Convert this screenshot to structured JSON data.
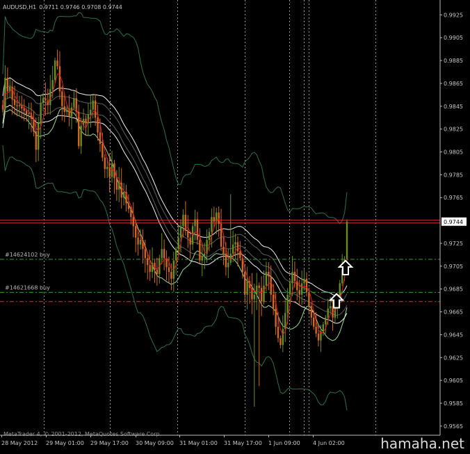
{
  "header": {
    "symbol": "AUDUSD,H1",
    "ohlc": "0.9711 0.9746 0.9708 0.9744"
  },
  "footer": {
    "copyright": "MetaTrader 4, © 2001-2012, MetaQuotes Software Corp.",
    "watermark": "hamaha.net"
  },
  "colors": {
    "background": "#000000",
    "grid": "#9a9a9a",
    "bull_candle": "#6b8e23",
    "bear_candle": "#d2691e",
    "red_ma": "#e02020",
    "bands": "#2f6f4f",
    "white_envelope": "#ffffff",
    "gray_envelope": "#a0a0a0",
    "green_envelope": "#b8ffb8",
    "bid_line": "#e03030",
    "order_line": "#3c9a3c",
    "stop_line": "#e03030",
    "price_tag": "#ffffff"
  },
  "chart_data": {
    "type": "candlestick",
    "y_axis_ticks": [
      "0.9925",
      "0.9905",
      "0.9885",
      "0.9865",
      "0.9845",
      "0.9825",
      "0.9805",
      "0.9785",
      "0.9765",
      "0.9744",
      "0.9725",
      "0.9705",
      "0.9685",
      "0.9665",
      "0.9645",
      "0.9625",
      "0.9605",
      "0.9585",
      "0.9565"
    ],
    "ylim": [
      0.9557,
      0.9938
    ],
    "x_axis_labels": [
      "28 May 2012",
      "29 May 01:00",
      "29 May 17:00",
      "30 May 09:00",
      "31 May 01:00",
      "31 May 17:00",
      "1 Jun 09:00",
      "4 Jun 02:00"
    ],
    "current_price": 0.9744,
    "orders": [
      {
        "label": "#14624102 buy",
        "price": 0.9711
      },
      {
        "label": "#14621668 buy",
        "price": 0.9682
      }
    ],
    "stop_price": 0.9674,
    "close_path": [
      0.9842,
      0.987,
      0.9858,
      0.9862,
      0.9851,
      0.9846,
      0.9845,
      0.9846,
      0.9843,
      0.9841,
      0.9838,
      0.9839,
      0.9834,
      0.9823,
      0.9807,
      0.983,
      0.9848,
      0.9852,
      0.985,
      0.9846,
      0.986,
      0.9868,
      0.9885,
      0.988,
      0.9858,
      0.9845,
      0.984,
      0.9842,
      0.9836,
      0.9844,
      0.9852,
      0.984,
      0.981,
      0.9828,
      0.9834,
      0.983,
      0.9838,
      0.9842,
      0.985,
      0.9835,
      0.9822,
      0.9812,
      0.98,
      0.979,
      0.9792,
      0.9783,
      0.9795,
      0.9782,
      0.9772,
      0.9778,
      0.9765,
      0.977,
      0.976,
      0.9755,
      0.9748,
      0.974,
      0.973,
      0.9724,
      0.9728,
      0.972,
      0.9712,
      0.9706,
      0.97,
      0.9708,
      0.9702,
      0.9698,
      0.9712,
      0.972,
      0.9712,
      0.9704,
      0.97,
      0.9694,
      0.971,
      0.972,
      0.973,
      0.974,
      0.975,
      0.9736,
      0.973,
      0.9724,
      0.974,
      0.9746,
      0.9728,
      0.971,
      0.9714,
      0.9716,
      0.9728,
      0.9735,
      0.9748,
      0.9744,
      0.9752,
      0.9742,
      0.9722,
      0.9716,
      0.9704,
      0.9708,
      0.9716,
      0.9724,
      0.9726,
      0.9718,
      0.9712,
      0.97,
      0.968,
      0.9692,
      0.9686,
      0.9676,
      0.968,
      0.9688,
      0.9686,
      0.9674,
      0.9688,
      0.97,
      0.9696,
      0.968,
      0.9668,
      0.9652,
      0.9642,
      0.9636,
      0.965,
      0.9664,
      0.968,
      0.969,
      0.97,
      0.9692,
      0.9684,
      0.968,
      0.969,
      0.9694,
      0.9682,
      0.967,
      0.966,
      0.9652,
      0.9646,
      0.964,
      0.9648,
      0.9654,
      0.966,
      0.9668,
      0.967,
      0.966,
      0.9668,
      0.9676,
      0.969,
      0.9702,
      0.9711,
      0.9744
    ]
  }
}
